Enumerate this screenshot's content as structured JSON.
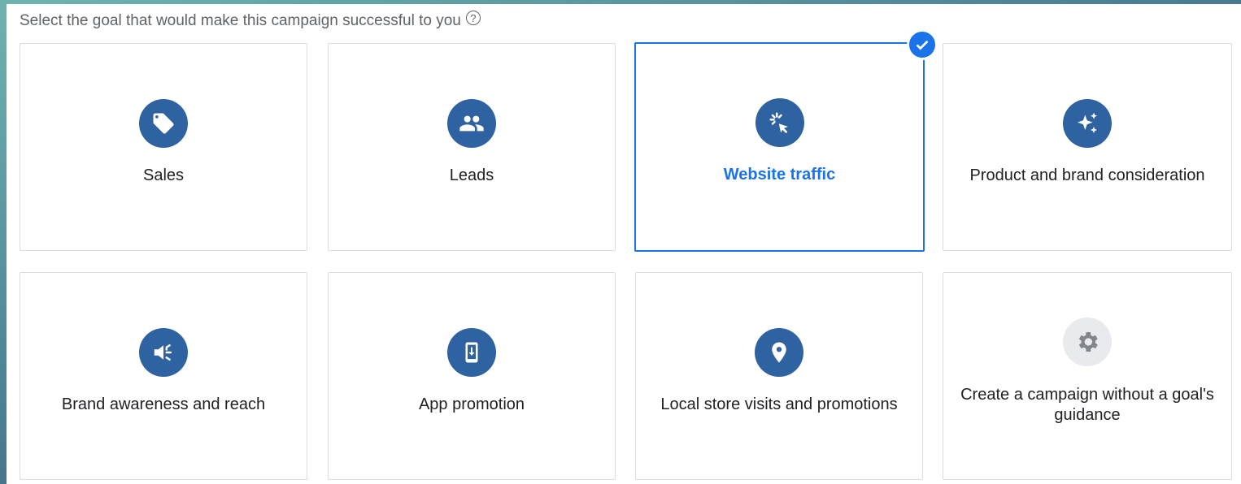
{
  "heading": {
    "text": "Select the goal that would make this campaign successful to you",
    "help_glyph": "?"
  },
  "accent_color": "#1a73e8",
  "icon_color": "#2f62a0",
  "goals": [
    {
      "label": "Sales",
      "icon": "tag-icon",
      "selected": false
    },
    {
      "label": "Leads",
      "icon": "people-icon",
      "selected": false
    },
    {
      "label": "Website traffic",
      "icon": "cursor-click-icon",
      "selected": true
    },
    {
      "label": "Product and brand consideration",
      "icon": "sparkle-icon",
      "selected": false
    },
    {
      "label": "Brand awareness and reach",
      "icon": "megaphone-icon",
      "selected": false
    },
    {
      "label": "App promotion",
      "icon": "phone-download-icon",
      "selected": false
    },
    {
      "label": "Local store visits and promotions",
      "icon": "location-pin-icon",
      "selected": false
    },
    {
      "label": "Create a campaign without a goal's guidance",
      "icon": "gear-icon",
      "selected": false
    }
  ]
}
